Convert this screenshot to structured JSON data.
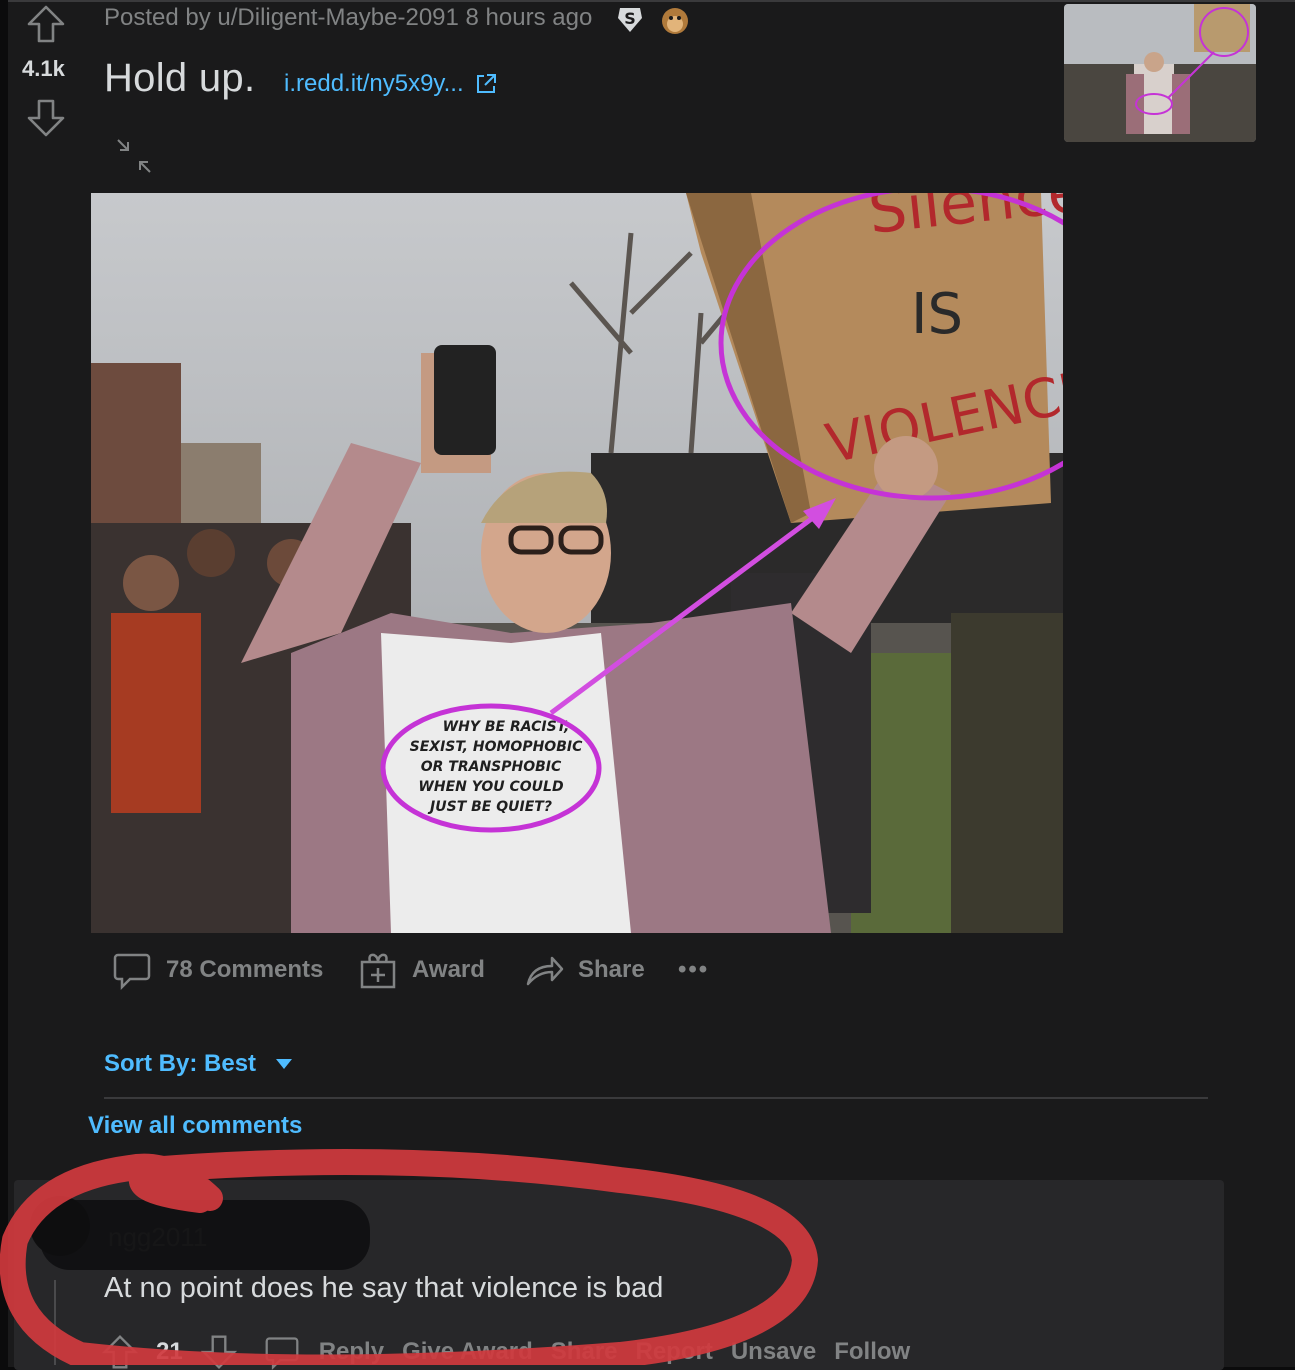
{
  "post": {
    "votes": "4.1k",
    "meta_text": "Posted by u/Diligent-Maybe-2091 8 hours ago",
    "title": "Hold up.",
    "link_text": "i.redd.it/ny5x9y...",
    "image": {
      "sign_word_1": "Silence",
      "sign_word_2": "IS",
      "sign_word_3": "VIOLENCE",
      "shirt_text": [
        "WHY BE RACIST,",
        "SEXIST, HOMOPHOBIC",
        "OR TRANSPHOBIC",
        "WHEN YOU COULD",
        "JUST BE QUIET?"
      ]
    },
    "actions": {
      "comments": "78 Comments",
      "award": "Award",
      "share": "Share",
      "more": "•••"
    }
  },
  "sort": {
    "label": "Sort By: Best"
  },
  "view_all": "View all comments",
  "comment": {
    "username": "ngg2011",
    "text": "At no point does he say that violence is bad",
    "score": "21",
    "actions": [
      "Reply",
      "Give Award",
      "Share",
      "Report",
      "Unsave",
      "Follow"
    ]
  },
  "colors": {
    "background": "#1a1a1b",
    "link": "#4fbcff",
    "muted": "#818384",
    "annotation_purple": "#c533d6",
    "annotation_red": "#d0393e"
  }
}
